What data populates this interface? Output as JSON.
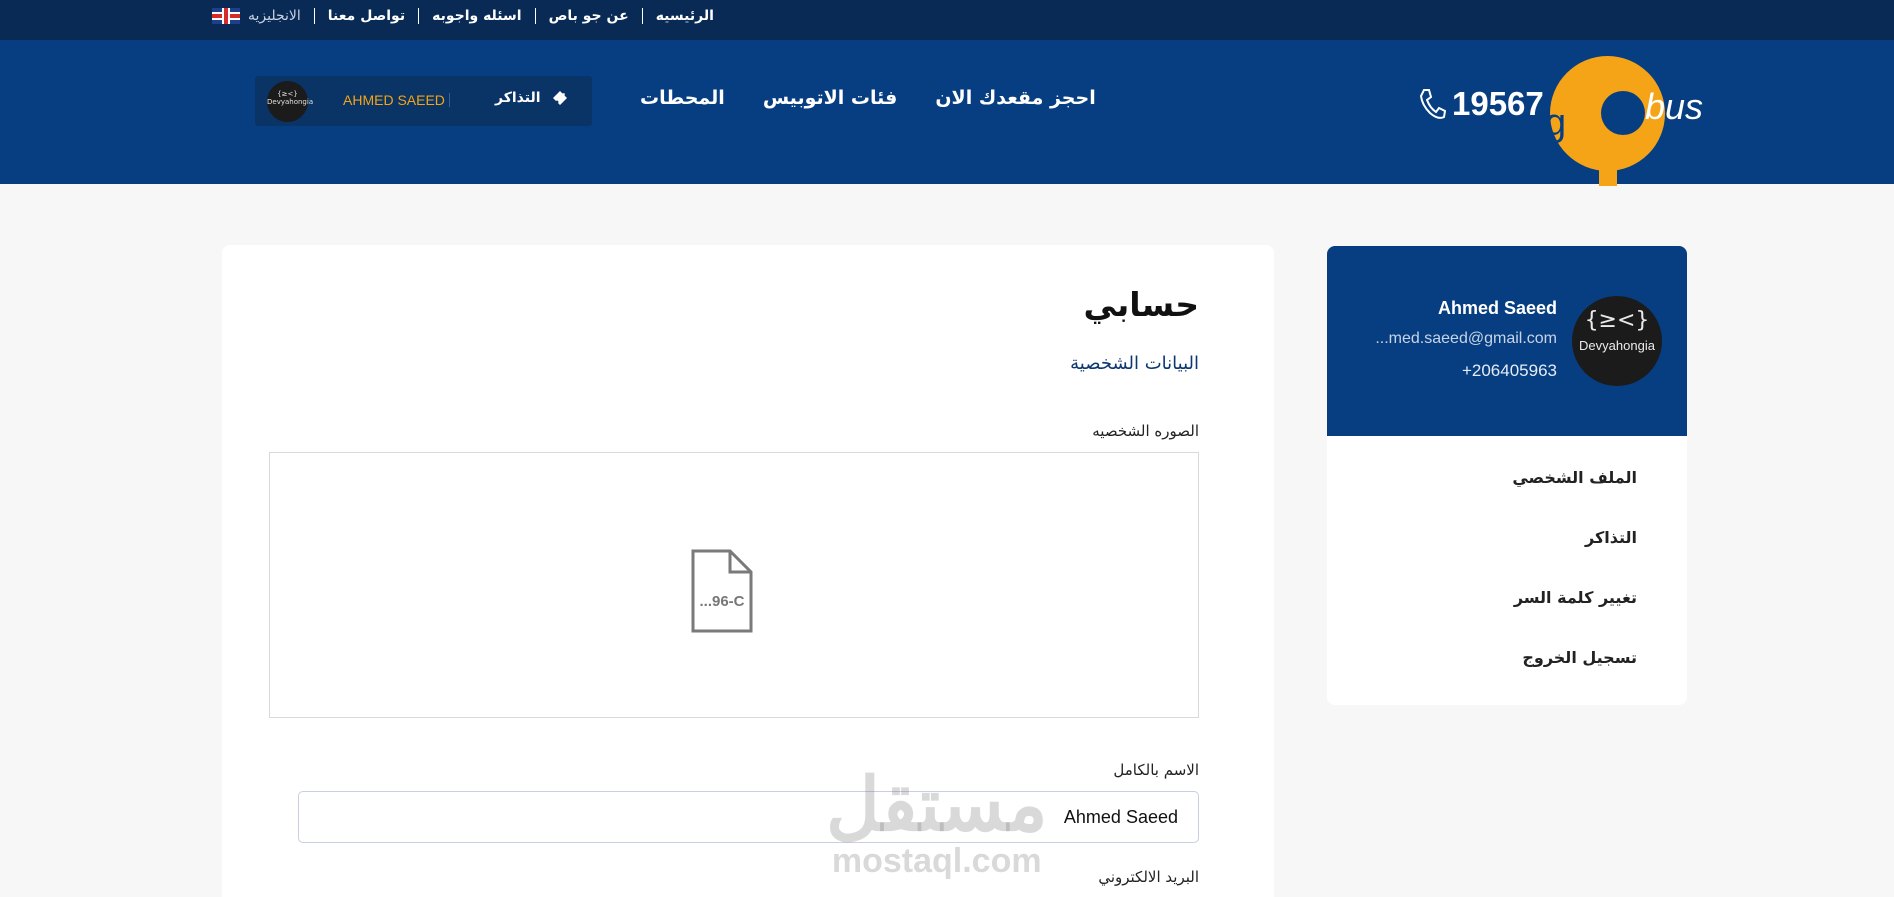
{
  "topbar": {
    "links": [
      "الرئيسيه",
      "عن جو باص",
      "اسئله واجوبه",
      "تواصل معنا"
    ],
    "language": "الانجليزيه"
  },
  "header": {
    "logo_text": [
      "g",
      "bus"
    ],
    "hotline": "19567",
    "nav": [
      "احجز مقعدك الان",
      "فئات الاتوبيس",
      "المحطات"
    ],
    "user_name": "AHMED SAEED",
    "tickets_label": "التذاكر",
    "avatar_text": "Devyahongia"
  },
  "main": {
    "title": "حسابي",
    "section": "البيانات الشخصية",
    "photo_label": "الصوره الشخصيه",
    "photo_placeholder": "...96-C",
    "fullname_label": "الاسم بالكامل",
    "fullname_value": "Ahmed Saeed",
    "email_label": "البريد الالكتروني"
  },
  "sidebar": {
    "name": "Ahmed Saeed",
    "email": "...med.saeed@gmail.com",
    "phone": "+206405963",
    "avatar_glyph": "{≥<}",
    "avatar_brand": "Devyahongia",
    "items": [
      "الملف الشخصي",
      "التذاكر",
      "تغيير كلمة السر",
      "تسجيل الخروج"
    ]
  },
  "watermark": {
    "arabic": "مستقل",
    "latin": "mostaql.com"
  },
  "colors": {
    "primary": "#073e82",
    "topbar": "#082a55",
    "accent": "#f4a416"
  }
}
